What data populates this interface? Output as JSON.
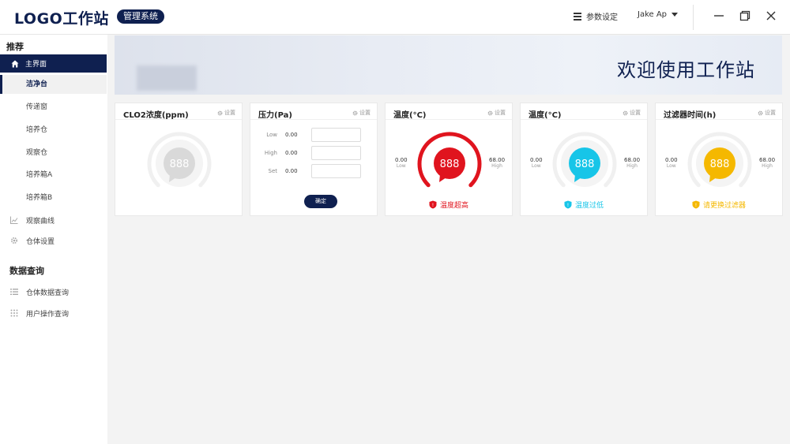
{
  "header": {
    "logo": "LOGO工作站",
    "system_badge": "管理系统",
    "settings_label": "参数设定",
    "user_name": "Jake Ap"
  },
  "sidebar": {
    "section_recommend": "推荐",
    "main_item": "主界面",
    "sub_items": [
      "洁净台",
      "传递窗",
      "培养仓",
      "观察仓",
      "培养箱A",
      "培养箱B"
    ],
    "observe_curve": "观察曲线",
    "chamber_settings": "仓体设置",
    "section_query": "数据查询",
    "chamber_data_query": "仓体数据查询",
    "user_op_query": "用户操作查询"
  },
  "banner": {
    "title": "欢迎使用工作站"
  },
  "cards": {
    "settings_label": "设置",
    "clo2": {
      "title": "CLO2浓度(ppm)",
      "value": "888"
    },
    "pressure": {
      "title": "压力(Pa)",
      "rows": [
        {
          "label": "Low",
          "value": "0.00"
        },
        {
          "label": "High",
          "value": "0.00"
        },
        {
          "label": "Set",
          "value": "0.00"
        }
      ],
      "confirm": "确定"
    },
    "temp_high": {
      "title": "温度(°C)",
      "value": "888",
      "min": "0.00",
      "min_label": "Low",
      "max": "68.00",
      "max_label": "High",
      "status": "温度超高",
      "color": "#e0141e"
    },
    "temp_low": {
      "title": "温度(°C)",
      "value": "888",
      "min": "0.00",
      "min_label": "Low",
      "max": "68.00",
      "max_label": "High",
      "status": "温度过低",
      "color": "#17c5e8"
    },
    "filter": {
      "title": "过滤器时间(h)",
      "value": "888",
      "min": "0.00",
      "min_label": "Low",
      "max": "68.00",
      "max_label": "High",
      "status": "请更换过滤器",
      "color": "#f5b800"
    }
  }
}
